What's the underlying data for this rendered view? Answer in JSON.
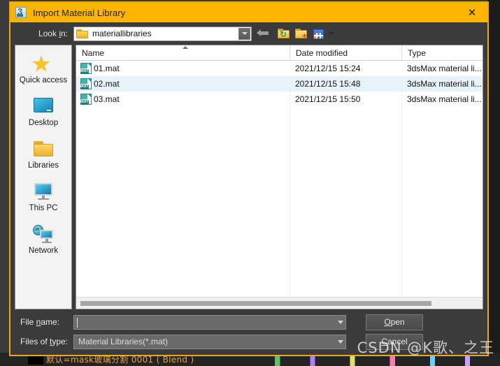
{
  "window": {
    "title": "Import Material Library",
    "app_icon": "3dsmax-icon",
    "close_label": "✕",
    "accent_color": "#ffb400",
    "border_color": "#f0a513"
  },
  "lookin": {
    "label_pre": "Look ",
    "label_accel": "i",
    "label_post": "n:",
    "value": "materiallibraries",
    "folder_icon": "folder-icon",
    "dropdown_icon": "chevron-down-icon"
  },
  "toolbar": {
    "items": [
      {
        "name": "back-button",
        "icon": "back-arrow-icon"
      },
      {
        "name": "up-one-level-button",
        "icon": "up-folder-icon"
      },
      {
        "name": "create-new-folder-button",
        "icon": "new-folder-icon"
      },
      {
        "name": "views-button",
        "icon": "views-grid-icon"
      }
    ]
  },
  "places": {
    "items": [
      {
        "label": "Quick access",
        "icon": "star-icon"
      },
      {
        "label": "Desktop",
        "icon": "desktop-icon"
      },
      {
        "label": "Libraries",
        "icon": "libraries-folder-icon"
      },
      {
        "label": "This PC",
        "icon": "this-pc-monitor-icon"
      },
      {
        "label": "Network",
        "icon": "network-globe-icon"
      }
    ]
  },
  "filelist": {
    "columns": [
      "Name",
      "Date modified",
      "Type"
    ],
    "sort_column": "Name",
    "sort_direction": "ascending",
    "rows": [
      {
        "name": "01.mat",
        "date": "2021/12/15 15:24",
        "type": "3dsMax material li...",
        "icon": "mat-file-icon",
        "selected": false
      },
      {
        "name": "02.mat",
        "date": "2021/12/15 15:48",
        "type": "3dsMax material li...",
        "icon": "mat-file-icon",
        "selected": true
      },
      {
        "name": "03.mat",
        "date": "2021/12/15 15:50",
        "type": "3dsMax material li...",
        "icon": "mat-file-icon",
        "selected": false
      }
    ],
    "selected_row_color": "#e8f3fc"
  },
  "filename": {
    "label_pre": "File ",
    "label_accel": "n",
    "label_post": "ame:",
    "value": "",
    "dropdown_icon": "chevron-down-icon"
  },
  "filetype": {
    "label_pre": "Files of ",
    "label_accel": "t",
    "label_post": "ype:",
    "value": "Material Libraries(*.mat)"
  },
  "buttons": {
    "open": {
      "pre": "",
      "accel": "O",
      "post": "pen"
    },
    "cancel": {
      "pre": "",
      "accel": "C",
      "post": "ancel"
    }
  },
  "watermark": "CSDN @K歌、之王",
  "background": {
    "label": "默认=mask玻璃分割 0001 ( Blend )"
  }
}
